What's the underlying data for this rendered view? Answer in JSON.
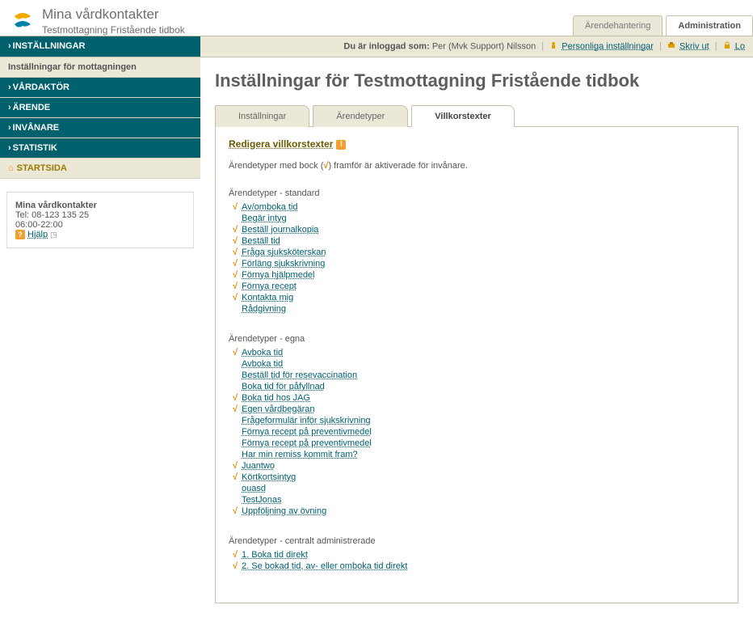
{
  "brand": {
    "title": "Mina vårdkontakter",
    "subtitle": "Testmottagning Fristående tidbok"
  },
  "topTabs": {
    "arende": "Ärendehantering",
    "admin": "Administration"
  },
  "loginBar": {
    "loggedAsLabel": "Du är inloggad som:",
    "user": "Per (Mvk Support) Nilsson",
    "personal": "Personliga inställningar",
    "print": "Skriv ut",
    "logout": "Lo"
  },
  "sidebar": {
    "header": "INSTÄLLNINGAR",
    "sub": "Inställningar för mottagningen",
    "items": [
      "VÅRDAKTÖR",
      "ÄRENDE",
      "INVÅNARE",
      "STATISTIK"
    ],
    "home": "STARTSIDA"
  },
  "info": {
    "title": "Mina vårdkontakter",
    "tel": "Tel: 08-123 135 25",
    "hours": "06:00-22:00",
    "help": "Hjälp"
  },
  "page": {
    "title": "Inställningar för Testmottagning Fristående tidbok",
    "tabs": [
      "Inställningar",
      "Ärendetyper",
      "Villkorstexter"
    ],
    "edit": "Redigera villkorstexter",
    "note_pre": "Ärendetyper med bock (",
    "note_post": ") framför är aktiverade för invånare."
  },
  "groups": [
    {
      "title": "Ärendetyper - standard",
      "items": [
        {
          "a": true,
          "l": "Av/omboka tid"
        },
        {
          "a": false,
          "l": "Begär intyg"
        },
        {
          "a": true,
          "l": "Beställ journalkopia"
        },
        {
          "a": true,
          "l": "Beställ tid"
        },
        {
          "a": true,
          "l": "Fråga sjuksköterskan"
        },
        {
          "a": true,
          "l": "Förläng sjukskrivning"
        },
        {
          "a": true,
          "l": "Förnya hjälpmedel"
        },
        {
          "a": true,
          "l": "Förnya recept"
        },
        {
          "a": true,
          "l": "Kontakta mig"
        },
        {
          "a": false,
          "l": "Rådgivning"
        }
      ]
    },
    {
      "title": "Ärendetyper - egna",
      "items": [
        {
          "a": true,
          "l": "Avboka tid"
        },
        {
          "a": false,
          "l": "Avboka tid"
        },
        {
          "a": false,
          "l": "Beställ tid för resevaccination"
        },
        {
          "a": false,
          "l": "Boka tid för påfyllnad"
        },
        {
          "a": true,
          "l": "Boka tid hos JAG"
        },
        {
          "a": true,
          "l": "Egen vårdbegäran"
        },
        {
          "a": false,
          "l": "Frågeformulär inför sjukskrivning"
        },
        {
          "a": false,
          "l": "Förnya recept på preventivmedel"
        },
        {
          "a": false,
          "l": "Förnya recept på preventivmedel"
        },
        {
          "a": false,
          "l": "Har min remiss kommit fram?"
        },
        {
          "a": true,
          "l": "Juantwo"
        },
        {
          "a": true,
          "l": "Körtkortsintyg"
        },
        {
          "a": false,
          "l": "ouasd"
        },
        {
          "a": false,
          "l": "TestJonas"
        },
        {
          "a": true,
          "l": "Uppföljning av övning"
        }
      ]
    },
    {
      "title": "Ärendetyper - centralt administrerade",
      "items": [
        {
          "a": true,
          "l": "1. Boka tid direkt"
        },
        {
          "a": true,
          "l": "2. Se bokad tid, av- eller omboka tid direkt"
        }
      ]
    }
  ]
}
